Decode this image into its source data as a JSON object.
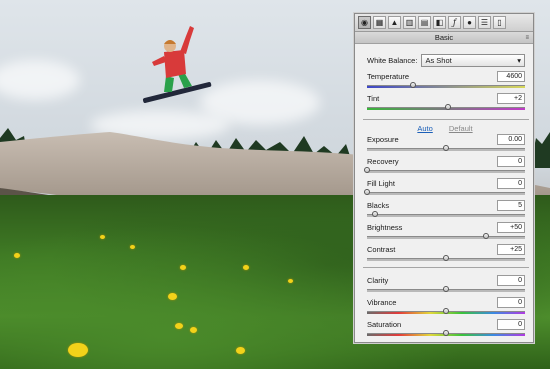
{
  "toolbar": {
    "icons": [
      "aperture-icon",
      "tone-curve-icon",
      "mountain-icon",
      "hsl-icon",
      "split-tone-icon",
      "lens-icon",
      "fx-icon",
      "camera-icon",
      "presets-icon",
      "snapshot-icon"
    ]
  },
  "panel": {
    "title": "Basic",
    "white_balance": {
      "label": "White Balance:",
      "value": "As Shot"
    },
    "auto_label": "Auto",
    "default_label": "Default",
    "sliders": [
      {
        "id": "temperature",
        "label": "Temperature",
        "value": "4600",
        "position": 0.29
      },
      {
        "id": "tint",
        "label": "Tint",
        "value": "+2",
        "position": 0.51
      },
      {
        "id": "exposure",
        "label": "Exposure",
        "value": "0.00",
        "position": 0.5
      },
      {
        "id": "recovery",
        "label": "Recovery",
        "value": "0",
        "position": 0.0
      },
      {
        "id": "fill-light",
        "label": "Fill Light",
        "value": "0",
        "position": 0.0
      },
      {
        "id": "blacks",
        "label": "Blacks",
        "value": "5",
        "position": 0.05
      },
      {
        "id": "brightness",
        "label": "Brightness",
        "value": "+50",
        "position": 0.75
      },
      {
        "id": "contrast",
        "label": "Contrast",
        "value": "+25",
        "position": 0.5
      },
      {
        "id": "clarity",
        "label": "Clarity",
        "value": "0",
        "position": 0.5
      },
      {
        "id": "vibrance",
        "label": "Vibrance",
        "value": "0",
        "position": 0.5
      },
      {
        "id": "saturation",
        "label": "Saturation",
        "value": "0",
        "position": 0.5
      }
    ]
  }
}
